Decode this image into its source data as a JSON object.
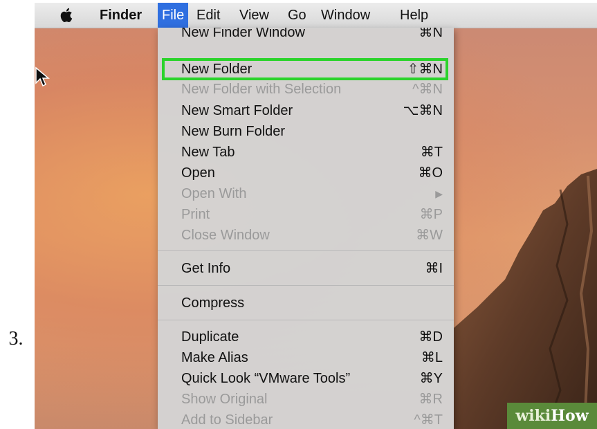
{
  "step": {
    "number": "3."
  },
  "menubar": {
    "items": [
      {
        "label": "Finder"
      },
      {
        "label": "File"
      },
      {
        "label": "Edit"
      },
      {
        "label": "View"
      },
      {
        "label": "Go"
      },
      {
        "label": "Window"
      },
      {
        "label": "Help"
      }
    ]
  },
  "file_menu": {
    "items": [
      {
        "label": "New Finder Window",
        "shortcut": "⌘N",
        "enabled": true
      },
      {
        "label": "New Folder",
        "shortcut": "⇧⌘N",
        "enabled": true,
        "highlighted": true
      },
      {
        "label": "New Folder with Selection",
        "shortcut": "^⌘N",
        "enabled": false
      },
      {
        "label": "New Smart Folder",
        "shortcut": "⌥⌘N",
        "enabled": true
      },
      {
        "label": "New Burn Folder",
        "shortcut": "",
        "enabled": true
      },
      {
        "label": "New Tab",
        "shortcut": "⌘T",
        "enabled": true
      },
      {
        "label": "Open",
        "shortcut": "⌘O",
        "enabled": true
      },
      {
        "label": "Open With",
        "shortcut": "▶",
        "enabled": false
      },
      {
        "label": "Print",
        "shortcut": "⌘P",
        "enabled": false
      },
      {
        "label": "Close Window",
        "shortcut": "⌘W",
        "enabled": false
      },
      {
        "label": "Get Info",
        "shortcut": "⌘I",
        "enabled": true
      },
      {
        "label": "Compress",
        "shortcut": "",
        "enabled": true
      },
      {
        "label": "Duplicate",
        "shortcut": "⌘D",
        "enabled": true
      },
      {
        "label": "Make Alias",
        "shortcut": "⌘L",
        "enabled": true
      },
      {
        "label": "Quick Look “VMware Tools”",
        "shortcut": "⌘Y",
        "enabled": true
      },
      {
        "label": "Show Original",
        "shortcut": "⌘R",
        "enabled": false
      },
      {
        "label": "Add to Sidebar",
        "shortcut": "^⌘T",
        "enabled": false
      }
    ]
  },
  "watermark": {
    "wiki": "wiki",
    "how": "How"
  },
  "colors": {
    "highlight": "#2bd32b",
    "menu_active": "#2f6fe0"
  },
  "icons": [
    "apple-icon",
    "mouse-pointer-icon"
  ]
}
